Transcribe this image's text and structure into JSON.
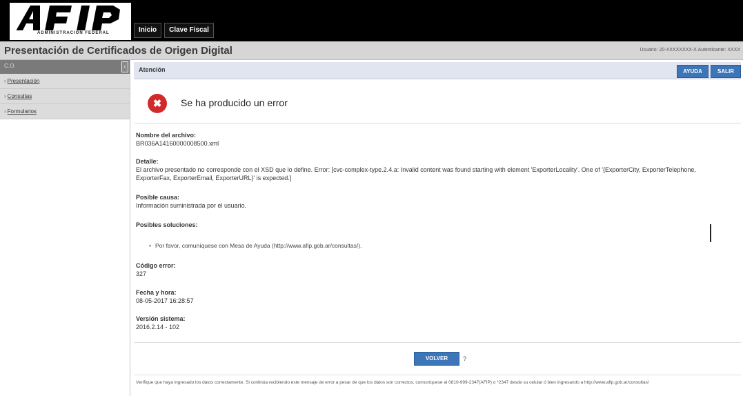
{
  "header": {
    "logo_text": "AFIP",
    "logo_subtitle": "ADMINISTRACION FEDERAL",
    "nav": [
      {
        "label": "Inicio"
      },
      {
        "label": "Clave Fiscal"
      }
    ]
  },
  "titlebar": {
    "title": "Presentación de Certificados de Origen Digital",
    "user_info": "Usuario: 20-XXXXXXXX-X Autenticante: XXXX"
  },
  "sidebar": {
    "header": "C.O.",
    "collapse_icon": "chevron-left-icon",
    "items": [
      {
        "label": "Presentación"
      },
      {
        "label": "Consultas"
      },
      {
        "label": "Formularios"
      }
    ]
  },
  "main": {
    "attention_label": "Atención",
    "ayuda_label": "AYUDA",
    "salir_label": "SALIR",
    "error_icon": "error-x-icon",
    "error_title": "Se ha producido un error",
    "file_name_label": "Nombre del archivo:",
    "file_name_value": "BR036A14160000008500.xml",
    "detail_label": "Detalle:",
    "detail_value": "El archivo presentado no corresponde con el XSD que lo define. Error: [cvc-complex-type.2.4.a: Invalid content was found starting with element 'ExporterLocality'. One of '{ExporterCity, ExporterTelephone, ExporterFax, ExporterEmail, ExporterURL}' is expected.]",
    "cause_label": "Posible causa:",
    "cause_value": "Información suministrada por el usuario.",
    "solutions_label": "Posibles soluciones:",
    "solutions": [
      "Por favor, comuníquese con Mesa de Ayuda (http://www.afip.gob.ar/consultas/)."
    ],
    "code_label": "Código error:",
    "code_value": "327",
    "date_label": "Fecha y hora:",
    "date_value": "08-05-2017 16:28:57",
    "version_label": "Versión sistema:",
    "version_value": "2016.2.14 - 102",
    "volver_label": "VOLVER",
    "help_question": "?",
    "footer_note": "Verifique que haya ingresado los datos correctamente. Si continúa recibiendo este mensaje de error a pesar de que los datos son correctos, comuníquese al 0810-999-2347(AFIP) o *2347 desde su celular ó bien ingresando a http://www.afip.gob.ar/consultas/"
  },
  "colors": {
    "accent_blue": "#3c76b8",
    "error_red": "#d12a2a",
    "header_black": "#000000"
  }
}
